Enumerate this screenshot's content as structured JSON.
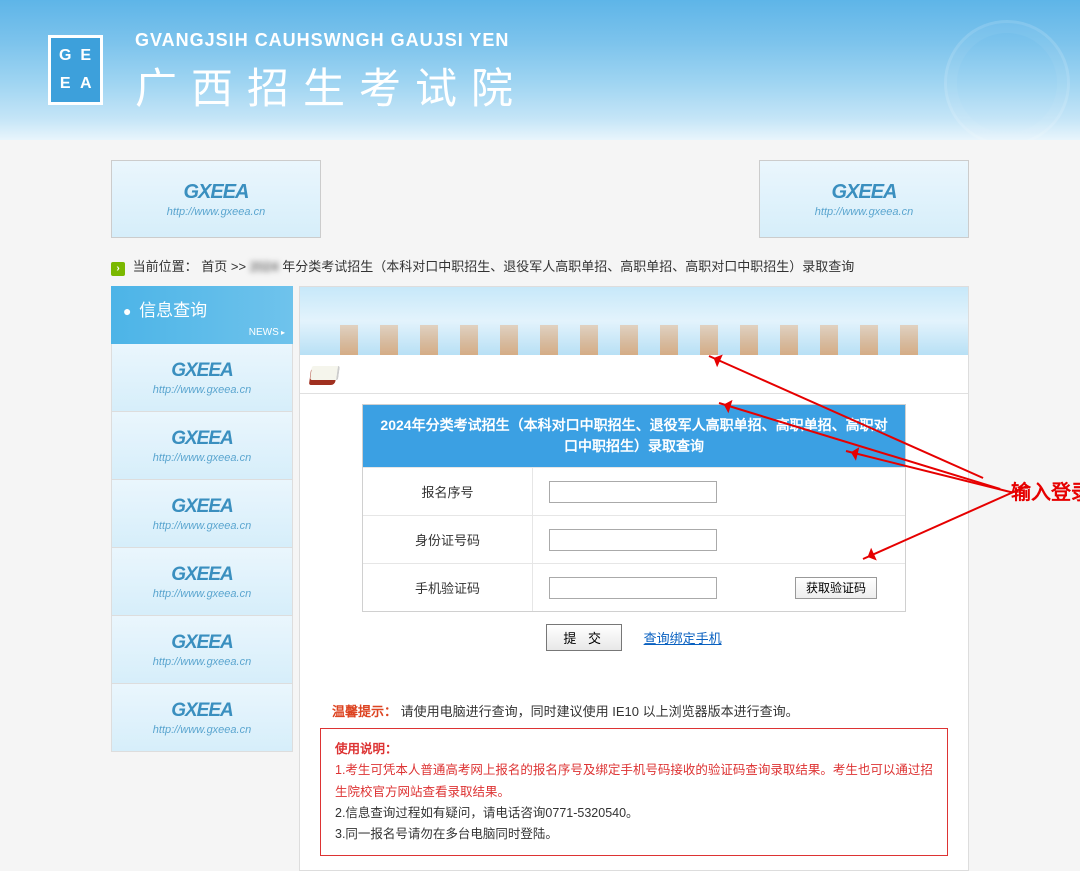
{
  "header": {
    "subtitle_latin": "GVANGJSIH CAUHSWNGH GAUJSI YEN",
    "title_cn": "广西招生考试院",
    "logo_letters": [
      "G",
      "E",
      "E",
      "A"
    ]
  },
  "ad": {
    "logo_text": "GXEEA",
    "url_text": "http://www.gxeea.cn"
  },
  "breadcrumb": {
    "prefix": "当前位置：",
    "home": "首页",
    "sep": ">>",
    "blur_text": "2024",
    "tail": "年分类考试招生（本科对口中职招生、退役军人高职单招、高职单招、高职对口中职招生）录取查询"
  },
  "sidebar": {
    "title": "信息查询",
    "news": "NEWS"
  },
  "form": {
    "title": "2024年分类考试招生（本科对口中职招生、退役军人高职单招、高职单招、高职对口中职招生）录取查询",
    "label_regno": "报名序号",
    "label_idno": "身份证号码",
    "label_code": "手机验证码",
    "btn_getcode": "获取验证码",
    "btn_submit": "提 交",
    "link_bindphone": "查询绑定手机"
  },
  "tip": {
    "label": "温馨提示：",
    "text": "请使用电脑进行查询，同时建议使用 IE10 以上浏览器版本进行查询。"
  },
  "instructions": {
    "title": "使用说明：",
    "line1": "1.考生可凭本人普通高考网上报名的报名序号及绑定手机号码接收的验证码查询录取结果。考生也可以通过招生院校官方网站查看录取结果。",
    "line2": "2.信息查询过程如有疑问，请电话咨询0771-5320540。",
    "line3": "3.同一报名号请勿在多台电脑同时登陆。"
  },
  "annotation": {
    "label": "输入登录"
  }
}
